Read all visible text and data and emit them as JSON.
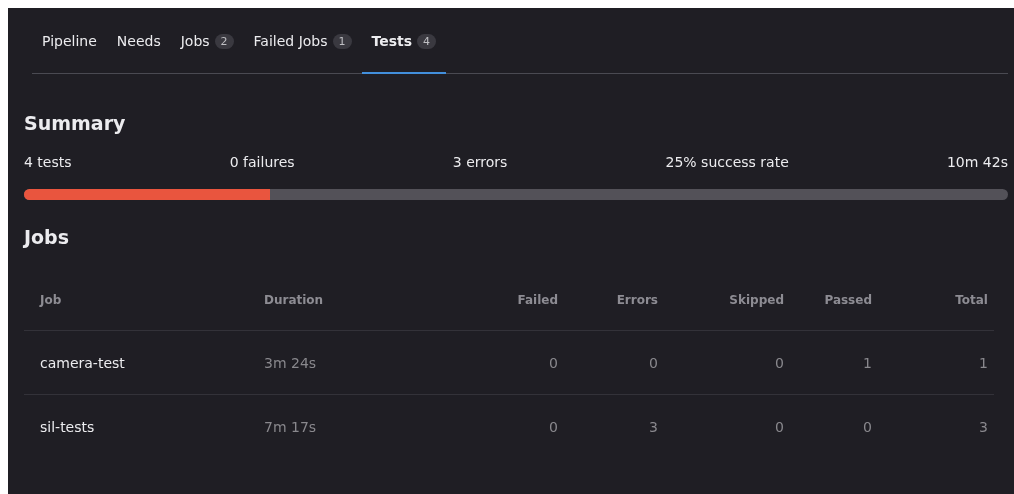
{
  "tabs": [
    {
      "label": "Pipeline",
      "selected": false
    },
    {
      "label": "Needs",
      "selected": false
    },
    {
      "label": "Jobs",
      "count": "2",
      "selected": false
    },
    {
      "label": "Failed Jobs",
      "count": "1",
      "selected": false
    },
    {
      "label": "Tests",
      "count": "4",
      "selected": true
    }
  ],
  "summary": {
    "title": "Summary",
    "stats": [
      "4 tests",
      "0 failures",
      "3 errors",
      "25% success rate",
      "10m 42s"
    ],
    "level": 0.25
  },
  "jobs": {
    "title": "Jobs",
    "columns": [
      "Job",
      "Duration",
      "Failed",
      "Errors",
      "Skipped",
      "Passed",
      "Total"
    ],
    "rows": [
      [
        "camera-test",
        "3m 24s",
        "0",
        "0",
        "0",
        "1",
        "1"
      ],
      [
        "sil-tests",
        "7m 17s",
        "0",
        "3",
        "0",
        "0",
        "3"
      ]
    ]
  }
}
